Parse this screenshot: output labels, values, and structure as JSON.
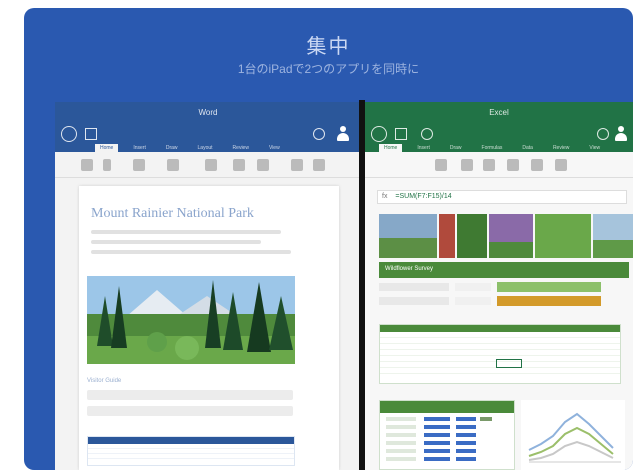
{
  "hero": {
    "title": "集中",
    "subtitle": "1台のiPadで2つのアプリを同時に"
  },
  "word": {
    "doc_name": "Word",
    "doc_sub": "",
    "tabs": [
      "Home",
      "Insert",
      "Draw",
      "Layout",
      "Review",
      "View"
    ],
    "doc_title": "Mount Rainier National Park",
    "section_heading": "Visitor Guide"
  },
  "excel": {
    "doc_name": "Excel",
    "doc_sub": "",
    "tabs": [
      "Home",
      "Insert",
      "Draw",
      "Formulas",
      "Data",
      "Review",
      "View"
    ],
    "formula_prefix": "fx",
    "formula_value": "=SUM(F7:F15)/14",
    "band_label": "Wildflower Survey"
  },
  "colors": {
    "frame": "#2a59b0",
    "word": "#2b579a",
    "excel": "#217346"
  }
}
